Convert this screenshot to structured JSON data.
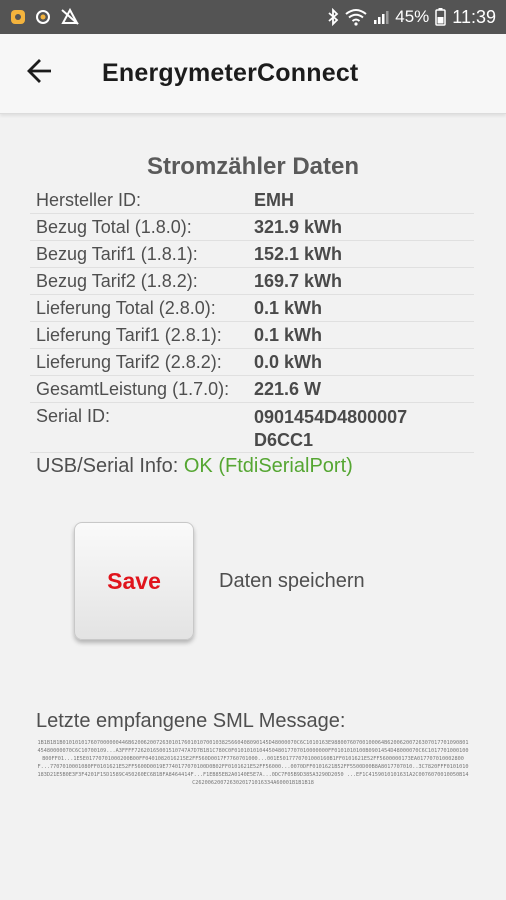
{
  "status_bar": {
    "left_icons": [
      "notification-icon",
      "app-icon",
      "no-location-icon"
    ],
    "right_icons": [
      "bluetooth-icon",
      "wifi-icon",
      "signal-icon",
      "battery-icon"
    ],
    "battery": "45%",
    "time": "11:39"
  },
  "app_bar": {
    "title": "EnergymeterConnect",
    "back_icon": "arrow-left-icon"
  },
  "meter": {
    "title": "Stromzähler Daten",
    "rows": [
      {
        "label": "Hersteller ID:",
        "value": "EMH"
      },
      {
        "label": "Bezug Total (1.8.0):",
        "value": "321.9 kWh"
      },
      {
        "label": "Bezug Tarif1 (1.8.1):",
        "value": "152.1 kWh"
      },
      {
        "label": "Bezug Tarif2 (1.8.2):",
        "value": "169.7 kWh"
      },
      {
        "label": "Lieferung Total (2.8.0):",
        "value": "0.1 kWh"
      },
      {
        "label": "Lieferung Tarif1 (2.8.1):",
        "value": "0.1 kWh"
      },
      {
        "label": "Lieferung Tarif2 (2.8.2):",
        "value": "0.0 kWh"
      },
      {
        "label": "GesamtLeistung (1.7.0):",
        "value": "221.6 W"
      },
      {
        "label": "Serial ID:",
        "value": "0901454D4800007",
        "value2": "D6CC1"
      }
    ]
  },
  "usb": {
    "label": "USB/Serial Info:",
    "status": "OK (FtdiSerialPort)",
    "status_color": "#55a632"
  },
  "save": {
    "button_label": "Save",
    "button_color": "#e0141c",
    "description": "Daten speichern"
  },
  "sml": {
    "title": "Letzte empfangene SML Message:",
    "message": "1B1B1B1B010101017607000000446B62006200726301017601010700103825660408090145D48000070C6C1010163E98800760700100064B6200620072630701770109080145480000070C6C10700109...A3FFFF72620165001510747A7D7B1B1C780C0F010101010445048017707010000000FF0101010100B0901454D48000070C6C1017701000100B00FF01...1E5E01770701000200B00FF0401082016215E2FF560D0017F7760701000...001E5017770701000160B1FF0101621E52FF5600000173EA017707010002800F...7707010001080FF0101621E52FF5600D0019E7740177070100D0B02FF0101621E52FF56000...0070DFF0101621B52FF5500D00B8A8017707010..3C7820FFF0101010183D21E5B0E3F3F4201F15D1589C450260EC6B1BFA8464414F...F1EB85EB2A0140E5E7A...0DC7F05B9D385A3290D2050 ...EF1C4159010101631A2C0076070010050B14C2620062007263020171016334A60001B1B1B18"
  }
}
